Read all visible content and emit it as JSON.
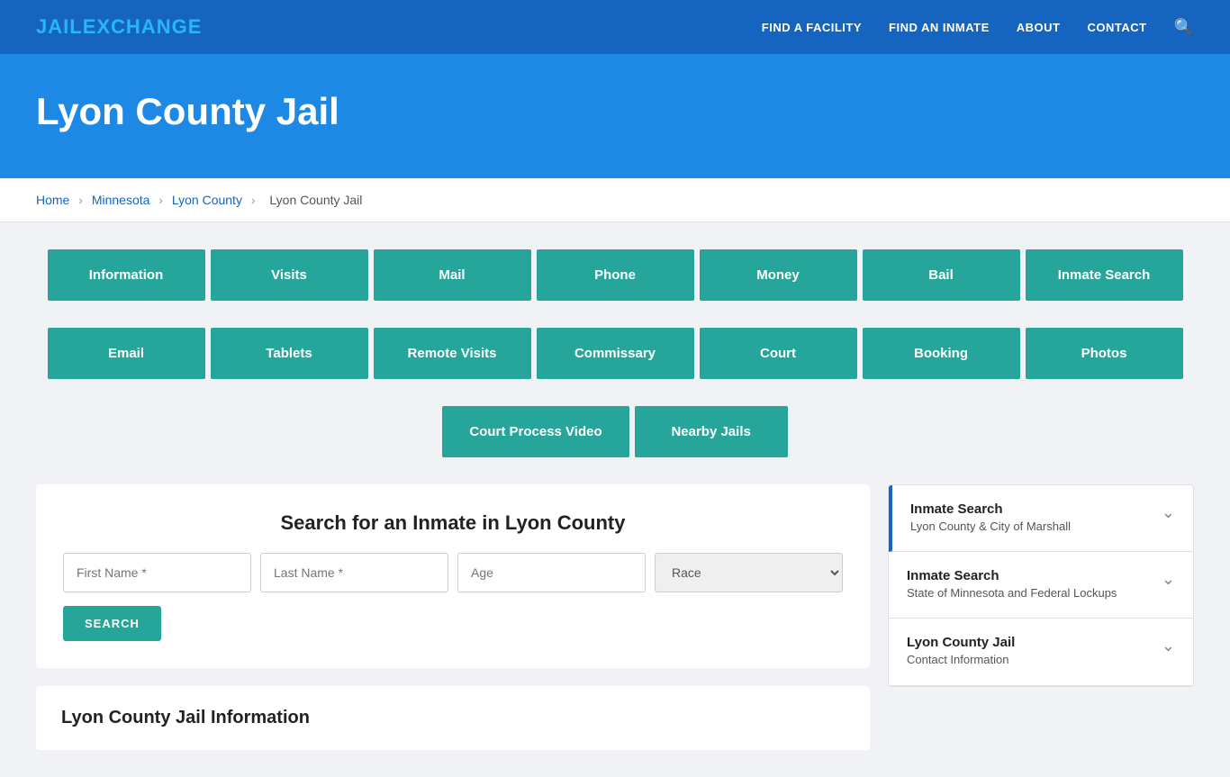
{
  "site": {
    "logo_jail": "JAIL",
    "logo_exchange": "EXCHANGE"
  },
  "nav": {
    "links": [
      {
        "id": "find-facility",
        "label": "FIND A FACILITY"
      },
      {
        "id": "find-inmate",
        "label": "FIND AN INMATE"
      },
      {
        "id": "about",
        "label": "ABOUT"
      },
      {
        "id": "contact",
        "label": "CONTACT"
      }
    ]
  },
  "hero": {
    "title": "Lyon County Jail"
  },
  "breadcrumb": {
    "items": [
      {
        "id": "home",
        "label": "Home"
      },
      {
        "id": "state",
        "label": "Minnesota"
      },
      {
        "id": "county",
        "label": "Lyon County"
      },
      {
        "id": "jail",
        "label": "Lyon County Jail"
      }
    ]
  },
  "buttons_row1": [
    {
      "id": "information",
      "label": "Information"
    },
    {
      "id": "visits",
      "label": "Visits"
    },
    {
      "id": "mail",
      "label": "Mail"
    },
    {
      "id": "phone",
      "label": "Phone"
    },
    {
      "id": "money",
      "label": "Money"
    },
    {
      "id": "bail",
      "label": "Bail"
    },
    {
      "id": "inmate-search",
      "label": "Inmate Search"
    }
  ],
  "buttons_row2": [
    {
      "id": "email",
      "label": "Email"
    },
    {
      "id": "tablets",
      "label": "Tablets"
    },
    {
      "id": "remote-visits",
      "label": "Remote Visits"
    },
    {
      "id": "commissary",
      "label": "Commissary"
    },
    {
      "id": "court",
      "label": "Court"
    },
    {
      "id": "booking",
      "label": "Booking"
    },
    {
      "id": "photos",
      "label": "Photos"
    }
  ],
  "buttons_row3": [
    {
      "id": "court-process-video",
      "label": "Court Process Video"
    },
    {
      "id": "nearby-jails",
      "label": "Nearby Jails"
    }
  ],
  "search": {
    "title": "Search for an Inmate in Lyon County",
    "first_name_placeholder": "First Name *",
    "last_name_placeholder": "Last Name *",
    "age_placeholder": "Age",
    "race_placeholder": "Race",
    "search_button": "SEARCH"
  },
  "sidebar": {
    "items": [
      {
        "id": "inmate-search-local",
        "title": "Inmate Search",
        "subtitle": "Lyon County & City of Marshall",
        "active": true
      },
      {
        "id": "inmate-search-state",
        "title": "Inmate Search",
        "subtitle": "State of Minnesota and Federal Lockups",
        "active": false
      },
      {
        "id": "contact-info",
        "title": "Lyon County Jail",
        "subtitle": "Contact Information",
        "active": false
      }
    ]
  },
  "info_section": {
    "title": "Lyon County Jail Information"
  },
  "colors": {
    "nav_bg": "#1565c0",
    "hero_bg": "#1e88e5",
    "teal": "#26a69a",
    "active_border": "#1565c0"
  }
}
